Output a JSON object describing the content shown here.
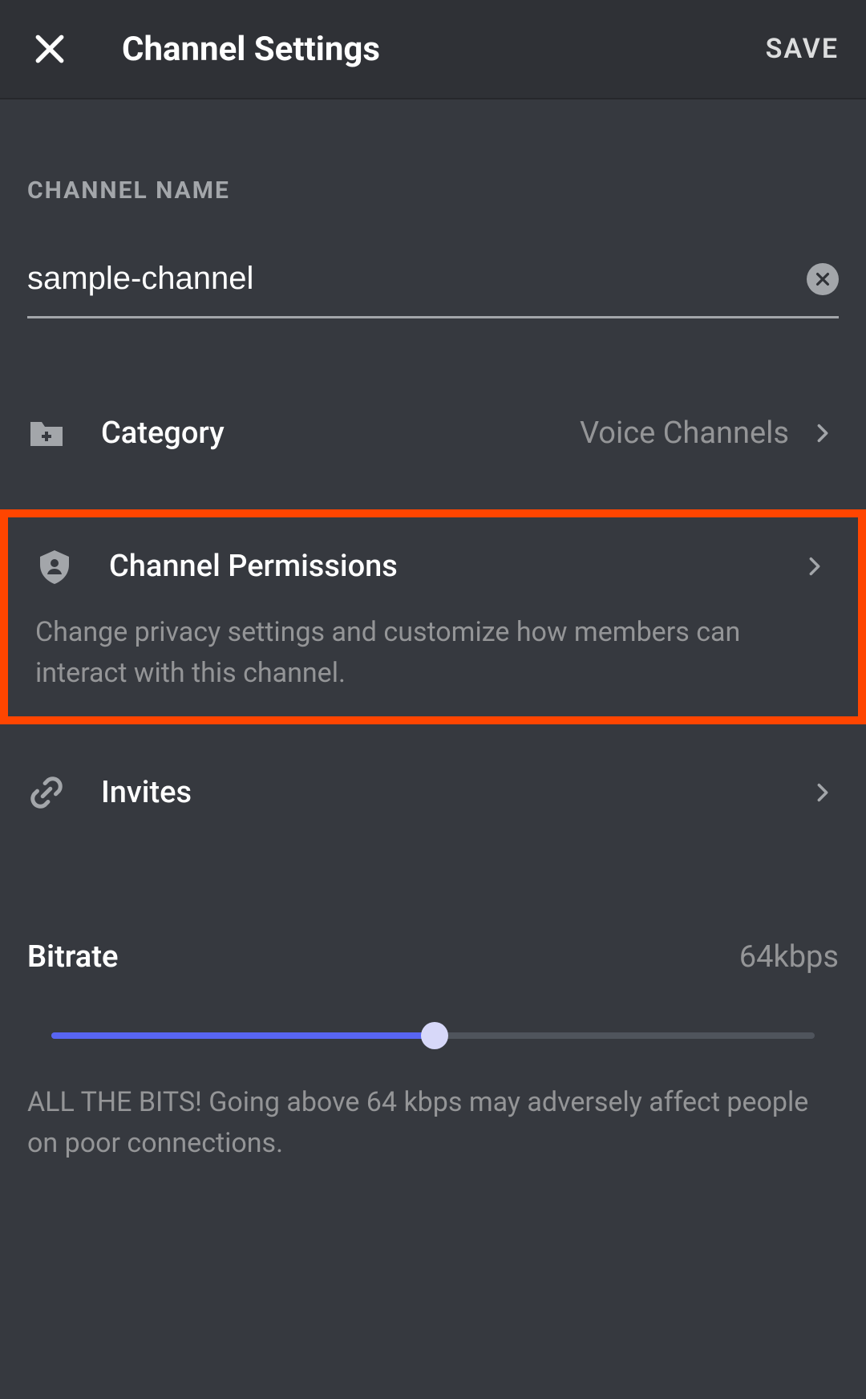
{
  "header": {
    "title": "Channel Settings",
    "save_label": "SAVE"
  },
  "channel_name": {
    "label": "CHANNEL NAME",
    "value": "sample-channel"
  },
  "rows": {
    "category": {
      "label": "Category",
      "value": "Voice Channels"
    },
    "permissions": {
      "label": "Channel Permissions",
      "description": "Change privacy settings and customize how members can interact with this channel."
    },
    "invites": {
      "label": "Invites"
    }
  },
  "bitrate": {
    "label": "Bitrate",
    "value": "64kbps",
    "description": "ALL THE BITS! Going above 64 kbps may adversely affect people on poor connections."
  }
}
